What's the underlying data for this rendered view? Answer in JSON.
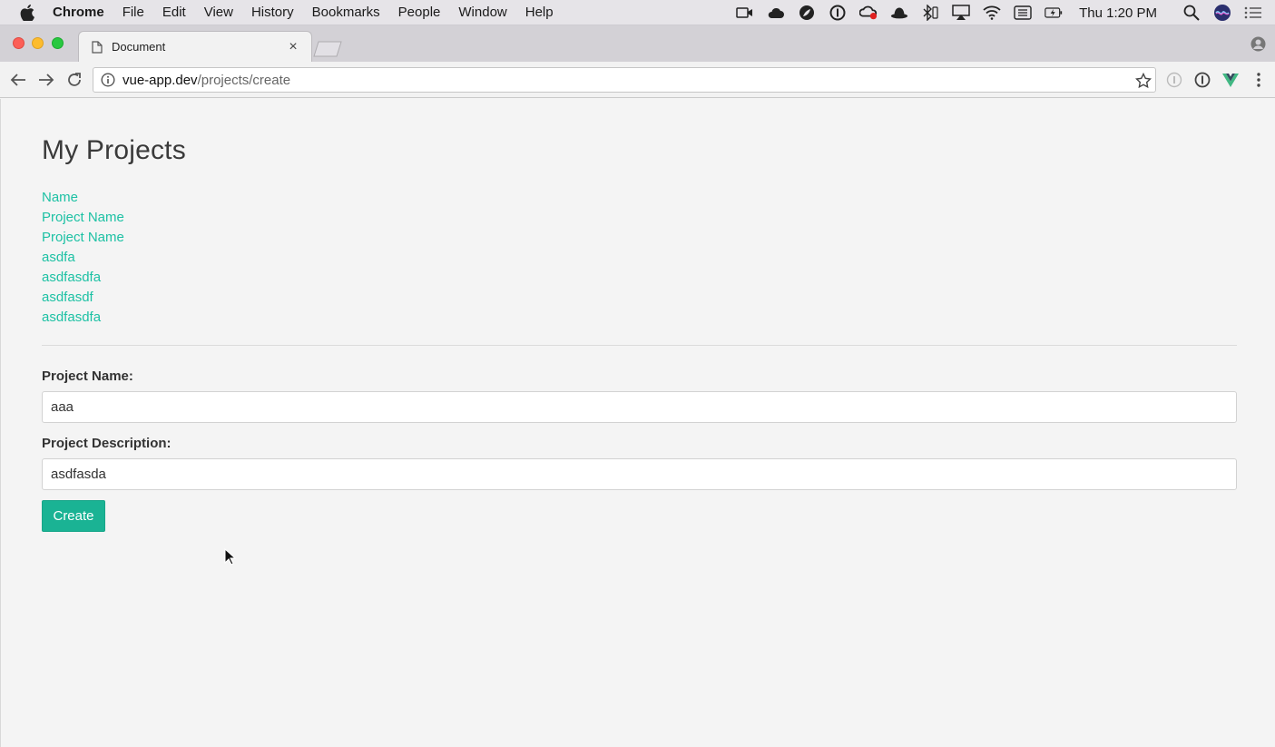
{
  "menubar": {
    "app_name": "Chrome",
    "items": [
      "File",
      "Edit",
      "View",
      "History",
      "Bookmarks",
      "People",
      "Window",
      "Help"
    ],
    "clock": "Thu 1:20 PM",
    "status_icons": [
      "facetime-icon",
      "cloud-icon",
      "leaf-icon",
      "onepassword-icon",
      "creative-cloud-icon",
      "bowler-hat-icon",
      "bluetooth-icon",
      "airplay-icon",
      "wifi-icon",
      "keyboard-icon",
      "battery-icon",
      "spotlight-icon",
      "siri-icon",
      "notification-center-icon"
    ]
  },
  "tab": {
    "title": "Document",
    "close": "×"
  },
  "omnibox": {
    "host": "vue-app.dev",
    "path": "/projects/create"
  },
  "page": {
    "title": "My Projects",
    "projects": [
      "Name",
      "Project Name",
      "Project Name",
      "asdfa",
      "asdfasdfa",
      "asdfasdf",
      "asdfasdfa"
    ],
    "form": {
      "name_label": "Project Name:",
      "name_value": "aaa",
      "description_label": "Project Description:",
      "description_value": "asdfasda",
      "submit_label": "Create"
    }
  },
  "colors": {
    "link": "#1dc1a4",
    "button": "#1ab394",
    "background": "#f4f4f4"
  }
}
